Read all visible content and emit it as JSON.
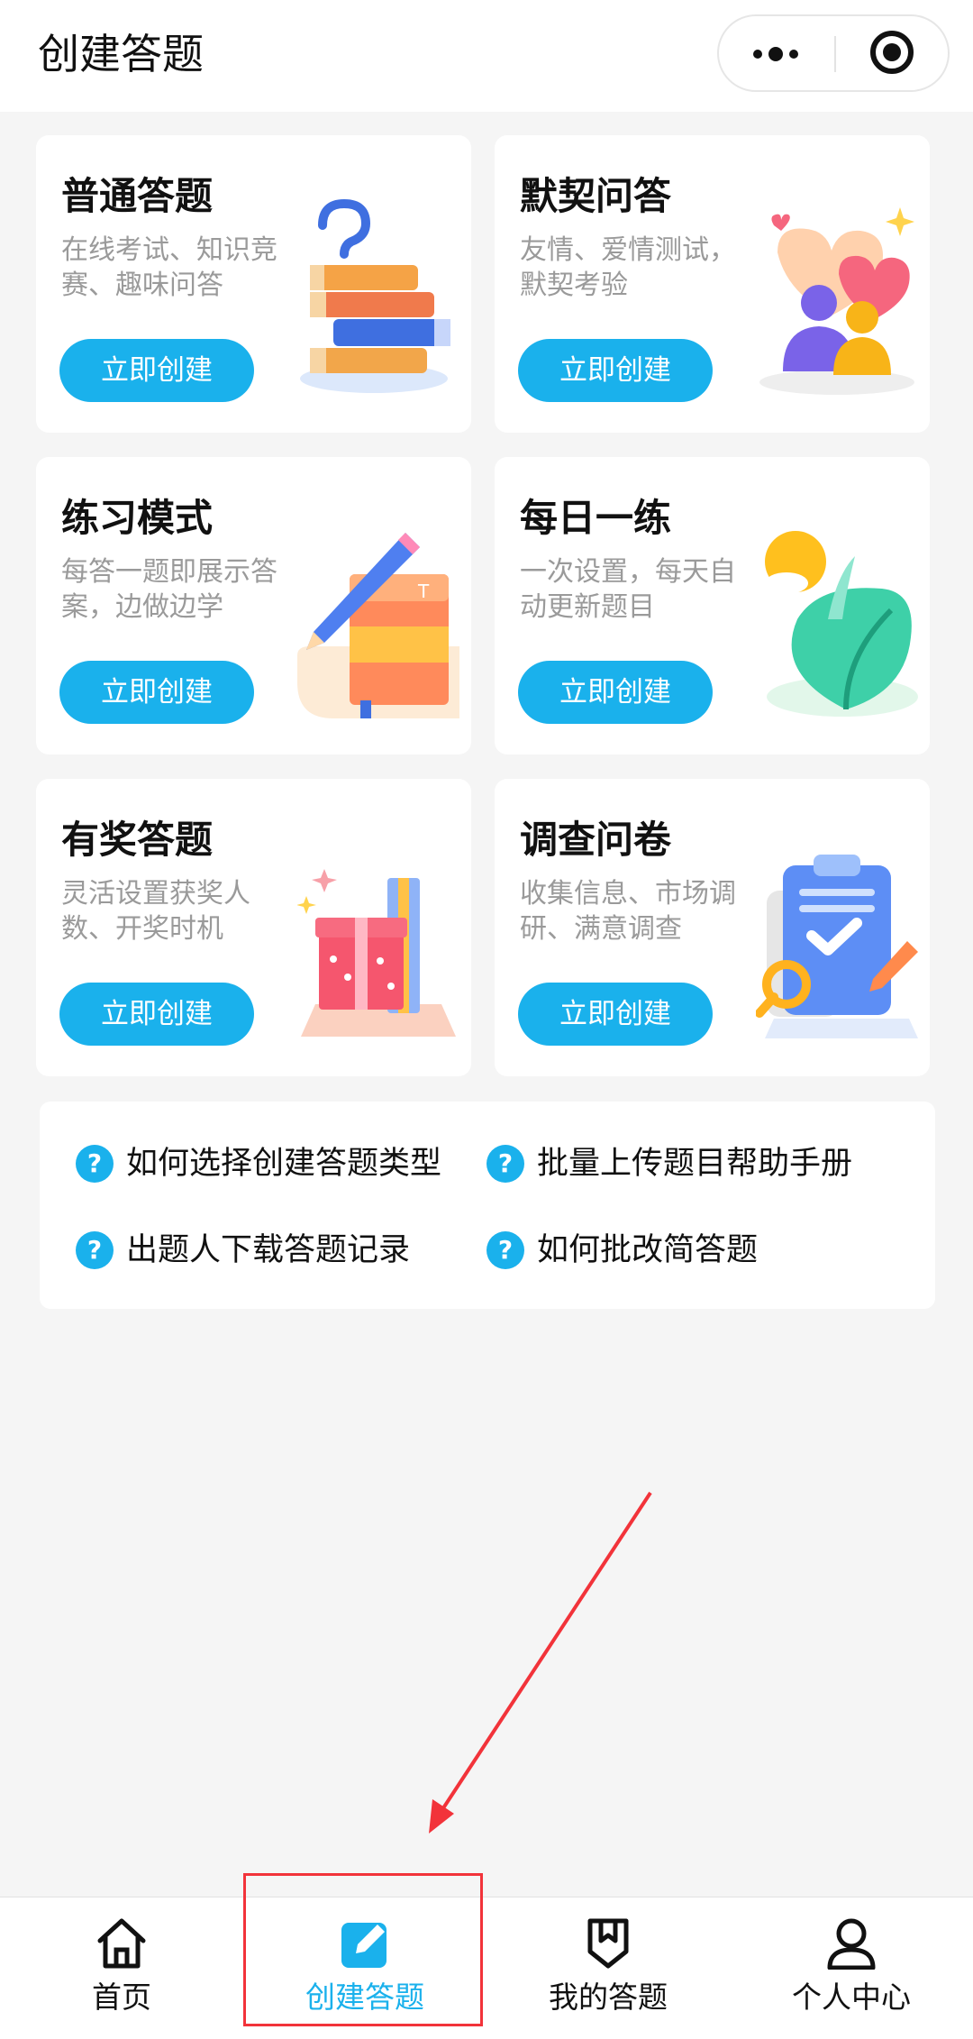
{
  "header": {
    "title": "创建答题"
  },
  "cards": [
    {
      "title": "普通答题",
      "desc": "在线考试、知识竞赛、趣味问答",
      "button": "立即创建",
      "icon": "books-question-illustration"
    },
    {
      "title": "默契问答",
      "desc": "友情、爱情测试，默契考验",
      "button": "立即创建",
      "icon": "hearts-people-illustration"
    },
    {
      "title": "练习模式",
      "desc": "每答一题即展示答案，边做边学",
      "button": "立即创建",
      "icon": "book-pencil-illustration"
    },
    {
      "title": "每日一练",
      "desc": "一次设置，每天自动更新题目",
      "button": "立即创建",
      "icon": "sun-leaf-illustration"
    },
    {
      "title": "有奖答题",
      "desc": "灵活设置获奖人数、开奖时机",
      "button": "立即创建",
      "icon": "gift-box-illustration"
    },
    {
      "title": "调查问卷",
      "desc": "收集信息、市场调研、满意调查",
      "button": "立即创建",
      "icon": "clipboard-illustration"
    }
  ],
  "help": [
    {
      "text": "如何选择创建答题类型"
    },
    {
      "text": "批量上传题目帮助手册"
    },
    {
      "text": "出题人下载答题记录"
    },
    {
      "text": "如何批改简答题"
    }
  ],
  "tabbar": {
    "items": [
      {
        "label": "首页",
        "icon": "home-icon"
      },
      {
        "label": "创建答题",
        "icon": "edit-icon",
        "active": true
      },
      {
        "label": "我的答题",
        "icon": "bookmark-shield-icon"
      },
      {
        "label": "个人中心",
        "icon": "user-icon"
      }
    ]
  },
  "colors": {
    "accent": "#1ab1ec",
    "annotation": "#f2333a",
    "background": "#f5f5f5"
  }
}
